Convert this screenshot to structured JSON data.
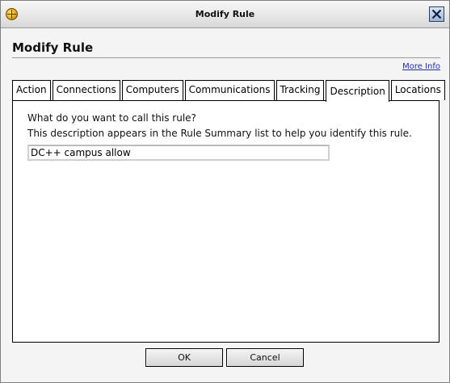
{
  "window": {
    "title": "Modify Rule",
    "app_icon": "globe-icon",
    "close_icon": "close-icon"
  },
  "dialog": {
    "heading": "Modify Rule",
    "more_info_link": "More Info"
  },
  "tabs": [
    {
      "label": "Action",
      "active": false
    },
    {
      "label": "Connections",
      "active": false
    },
    {
      "label": "Computers",
      "active": false
    },
    {
      "label": "Communications",
      "active": false
    },
    {
      "label": "Tracking",
      "active": false
    },
    {
      "label": "Description",
      "active": true
    },
    {
      "label": "Locations",
      "active": false
    }
  ],
  "description_panel": {
    "prompt": "What do you want to call this rule?",
    "help": "This description appears in the Rule Summary list to help you identify this rule.",
    "rule_name_value": "DC++ campus allow"
  },
  "buttons": {
    "ok_label": "OK",
    "cancel_label": "Cancel"
  },
  "colors": {
    "link": "#1c2fa0",
    "close_button": "#9fb6d8"
  }
}
